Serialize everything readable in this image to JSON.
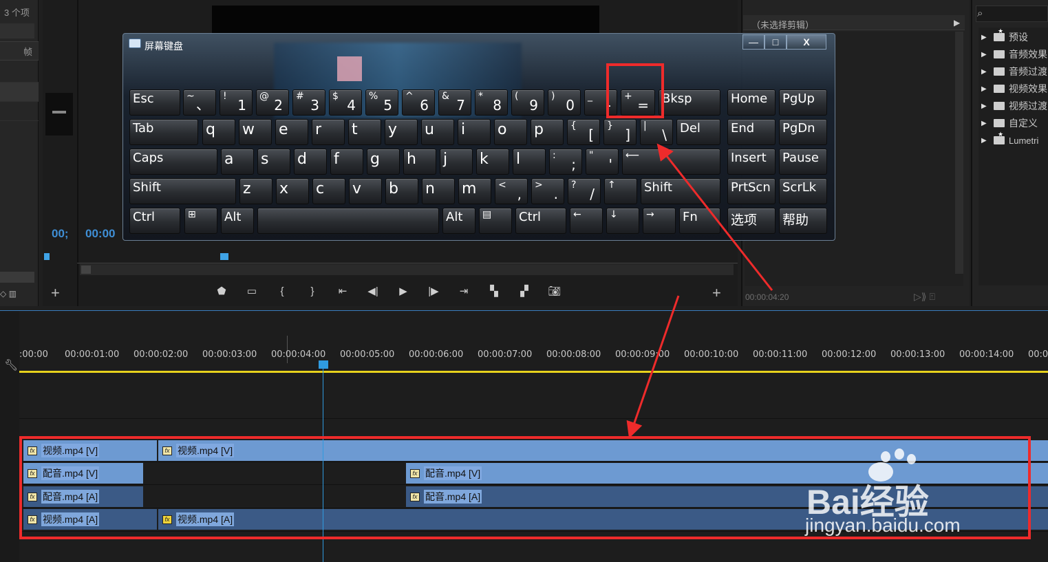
{
  "project": {
    "item_count": "3 个项",
    "frame_label": "帧"
  },
  "source": {
    "timecode": "00;"
  },
  "program": {
    "timecode": "00:00"
  },
  "effect_controls": {
    "title": "（未选择剪辑）",
    "timecode": "00:00:04:20"
  },
  "effects": {
    "items": [
      {
        "label": "预设",
        "star": true
      },
      {
        "label": "音频效果",
        "star": false
      },
      {
        "label": "音频过渡",
        "star": false
      },
      {
        "label": "视频效果",
        "star": false
      },
      {
        "label": "视频过渡",
        "star": false
      },
      {
        "label": "自定义",
        "star": false
      },
      {
        "label": "Lumetri",
        "star": true
      }
    ]
  },
  "osk": {
    "title": "屏幕键盘",
    "minimize": "—",
    "maximize": "□",
    "close": "X",
    "keys": {
      "esc": "Esc",
      "tilde_top": "~",
      "tilde_low": "、",
      "d1_top": "!",
      "d1": "1",
      "d2_top": "@",
      "d2": "2",
      "d3_top": "#",
      "d3": "3",
      "d4_top": "$",
      "d4": "4",
      "d5_top": "%",
      "d5": "5",
      "d6_top": "^",
      "d6": "6",
      "d7_top": "&",
      "d7": "7",
      "d8_top": "*",
      "d8": "8",
      "d9_top": "(",
      "d9": "9",
      "d0_top": ")",
      "d0": "0",
      "minus_top": "_",
      "minus": "-",
      "plus_top": "+",
      "equals": "=",
      "bksp": "Bksp",
      "home": "Home",
      "pgup": "PgUp",
      "tab": "Tab",
      "q": "q",
      "w": "w",
      "e": "e",
      "r": "r",
      "t": "t",
      "y": "y",
      "u": "u",
      "i": "i",
      "o": "o",
      "p": "p",
      "lbrace": "{",
      "lbracket": "[",
      "rbrace": "}",
      "rbracket": "]",
      "pipe": "|",
      "backslash": "\\",
      "del": "Del",
      "end": "End",
      "pgdn": "PgDn",
      "caps": "Caps",
      "a": "a",
      "s": "s",
      "d": "d",
      "f": "f",
      "g": "g",
      "h": "h",
      "j": "j",
      "k": "k",
      "l": "l",
      "colon": ":",
      "semicolon": ";",
      "quote_top": "\"",
      "quote": "'",
      "enter": "⟵",
      "insert": "Insert",
      "pause": "Pause",
      "shift_l": "Shift",
      "z": "z",
      "x": "x",
      "c": "c",
      "v": "v",
      "b": "b",
      "n": "n",
      "m": "m",
      "lt": "<",
      "comma": ",",
      "gt": ">",
      "period": ".",
      "question": "?",
      "slash": "/",
      "up": "↑",
      "shift_r": "Shift",
      "prtscn": "PrtScn",
      "scrlk": "ScrLk",
      "ctrl_l": "Ctrl",
      "win": "⊞",
      "alt_l": "Alt",
      "alt_r": "Alt",
      "menu": "▤",
      "ctrl_r": "Ctrl",
      "left": "←",
      "down": "↓",
      "right": "→",
      "fn": "Fn",
      "options": "选项",
      "help": "帮助"
    }
  },
  "timeline": {
    "timecodes": [
      ":00:00",
      "00:00:01:00",
      "00:00:02:00",
      "00:00:03:00",
      "00:00:04:00",
      "00:00:05:00",
      "00:00:06:00",
      "00:00:07:00",
      "00:00:08:00",
      "00:00:09:00",
      "00:00:10:00",
      "00:00:11:00",
      "00:00:12:00",
      "00:00:13:00",
      "00:00:14:00",
      "00:0"
    ],
    "clips": {
      "v2_a": "视频.mp4 [V]",
      "v2_b": "视频.mp4 [V]",
      "v1_a": "配音.mp4 [V]",
      "v1_b": "配音.mp4 [V]",
      "a1_a": "配音.mp4 [A]",
      "a1_b": "配音.mp4 [A]",
      "a2_a": "视频.mp4 [A]",
      "a2_b": "视频.mp4 [A]"
    },
    "fx_badge": "fx"
  },
  "watermark": {
    "brand": "Bai经验",
    "url": "jingyan.baidu.com"
  },
  "colors": {
    "accent_blue": "#3f8fd6",
    "annotation_red": "#ee2b2b",
    "video_clip": "#6d9ad2",
    "audio_clip": "#3b5a86",
    "work_area": "#e7d21c"
  }
}
